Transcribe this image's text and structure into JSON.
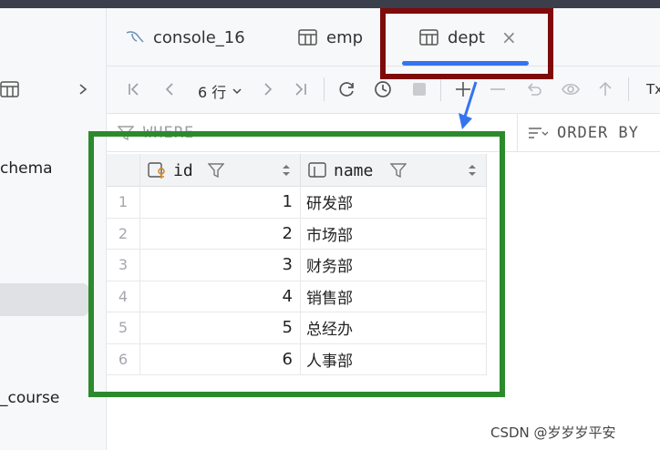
{
  "sidebar": {
    "item_schema": "chema",
    "item_course": "_course"
  },
  "tabs": [
    {
      "label": "console_16"
    },
    {
      "label": "emp"
    },
    {
      "label": "dept",
      "close": "×"
    }
  ],
  "toolbar": {
    "rows_label": "6 行",
    "tx_label": "Tx"
  },
  "filter": {
    "where": "WHERE",
    "order_by": "ORDER BY"
  },
  "table": {
    "columns": [
      "id",
      "name"
    ],
    "rows": [
      {
        "num": "1",
        "id": "1",
        "name": "研发部"
      },
      {
        "num": "2",
        "id": "2",
        "name": "市场部"
      },
      {
        "num": "3",
        "id": "3",
        "name": "财务部"
      },
      {
        "num": "4",
        "id": "4",
        "name": "销售部"
      },
      {
        "num": "5",
        "id": "5",
        "name": "总经办"
      },
      {
        "num": "6",
        "id": "6",
        "name": "人事部"
      }
    ]
  },
  "watermark": "CSDN @岁岁岁平安",
  "colors": {
    "accent": "#3574f0",
    "annotation_red": "#7f0a0a",
    "annotation_green": "#2c8a2c"
  }
}
